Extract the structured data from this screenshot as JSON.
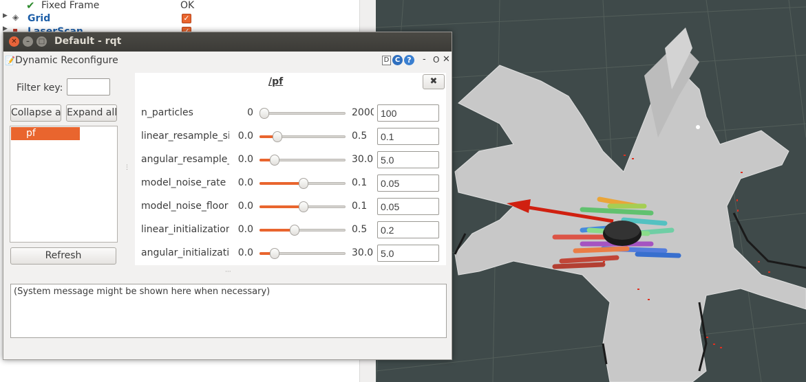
{
  "rviz": {
    "displays": [
      {
        "label": "Fixed Frame",
        "value": "OK",
        "status": "ok"
      },
      {
        "label": "Grid",
        "value": "checked"
      },
      {
        "label": "LaserScan",
        "value": "checked"
      }
    ]
  },
  "window": {
    "title": "Default - rqt",
    "plugin_title": "Dynamic Reconfigure",
    "header_controls": {
      "d": "D",
      "reload": "C",
      "help": "?",
      "minimize": "-",
      "float": "O",
      "close": "✕"
    }
  },
  "left": {
    "filter_label": "Filter key:",
    "filter_value": "",
    "collapse_label": "Collapse all",
    "expand_label": "Expand all",
    "nodes": [
      "pf"
    ],
    "refresh_label": "Refresh"
  },
  "node_panel": {
    "title": "/pf",
    "close_label": "✖",
    "params": [
      {
        "name": "n_particles",
        "min": "0",
        "max": "2000",
        "value": "100",
        "fraction": 0.05
      },
      {
        "name": "linear_resample_sigma",
        "min": "0.0",
        "max": "0.5",
        "value": "0.1",
        "fraction": 0.2
      },
      {
        "name": "angular_resample_sigma",
        "min": "0.0",
        "max": "30.0",
        "value": "5.0",
        "fraction": 0.167
      },
      {
        "name": "model_noise_rate",
        "min": "0.0",
        "max": "0.1",
        "value": "0.05",
        "fraction": 0.5
      },
      {
        "name": "model_noise_floor",
        "min": "0.0",
        "max": "0.1",
        "value": "0.05",
        "fraction": 0.5
      },
      {
        "name": "linear_initialization_sigma",
        "min": "0.0",
        "max": "0.5",
        "value": "0.2",
        "fraction": 0.4
      },
      {
        "name": "angular_initialization_sigma",
        "min": "0.0",
        "max": "30.0",
        "value": "5.0",
        "fraction": 0.167
      }
    ]
  },
  "status": {
    "message": "(System message might be shown here when necessary)"
  },
  "colors": {
    "accent": "#e9652e",
    "titlebar": "#3c3b37",
    "floor": "#c9c9c9",
    "background3d": "#3f4a4a"
  }
}
